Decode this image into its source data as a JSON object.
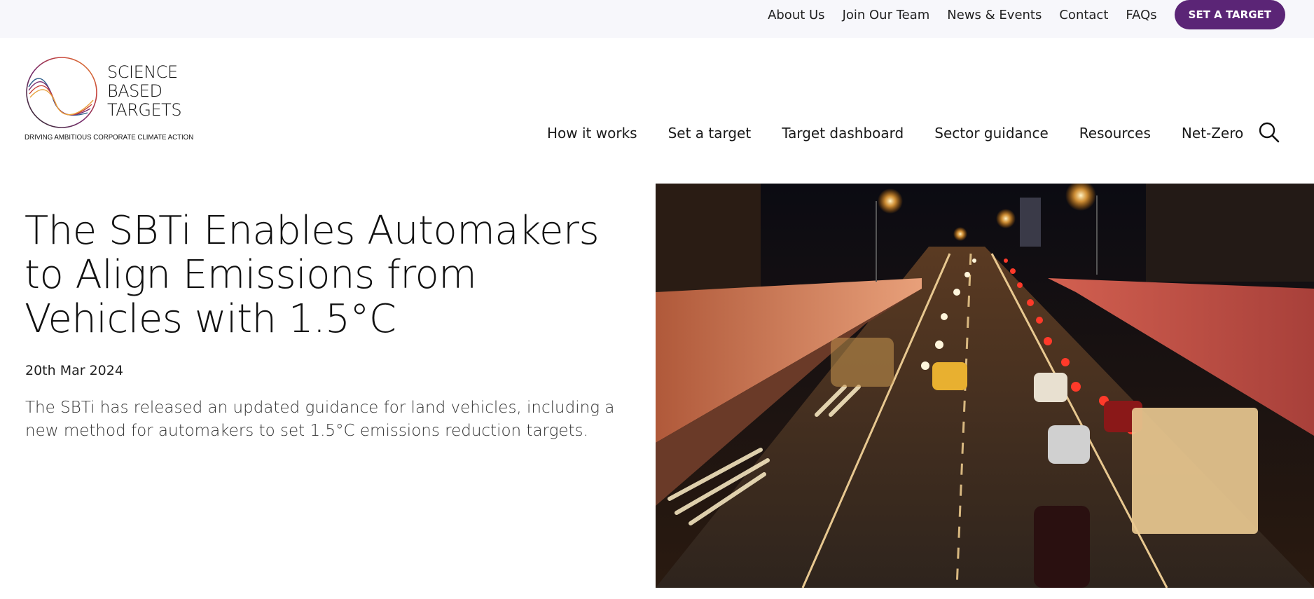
{
  "utility_nav": {
    "links": [
      "About Us",
      "Join Our Team",
      "News & Events",
      "Contact",
      "FAQs"
    ],
    "cta_label": "SET A TARGET",
    "cta_color": "#5b2576"
  },
  "logo": {
    "lines": [
      "SCIENCE",
      "BASED",
      "TARGETS"
    ],
    "tagline": "DRIVING AMBITIOUS CORPORATE CLIMATE ACTION",
    "colors": [
      "#e8a33d",
      "#c8433a",
      "#7a2e6e",
      "#2c5d8a",
      "#2a2a2a"
    ]
  },
  "main_nav": {
    "items": [
      "How it works",
      "Set a target",
      "Target dashboard",
      "Sector guidance",
      "Resources",
      "Net-Zero"
    ],
    "search_icon": "search-icon"
  },
  "article": {
    "title": "The SBTi Enables Automakers to Align Emissions from Vehicles with 1.5°C",
    "date": "20th Mar 2024",
    "summary": "The SBTi has released an updated guidance for land vehicles, including a new method for automakers to set 1.5°C emissions reduction targets."
  }
}
